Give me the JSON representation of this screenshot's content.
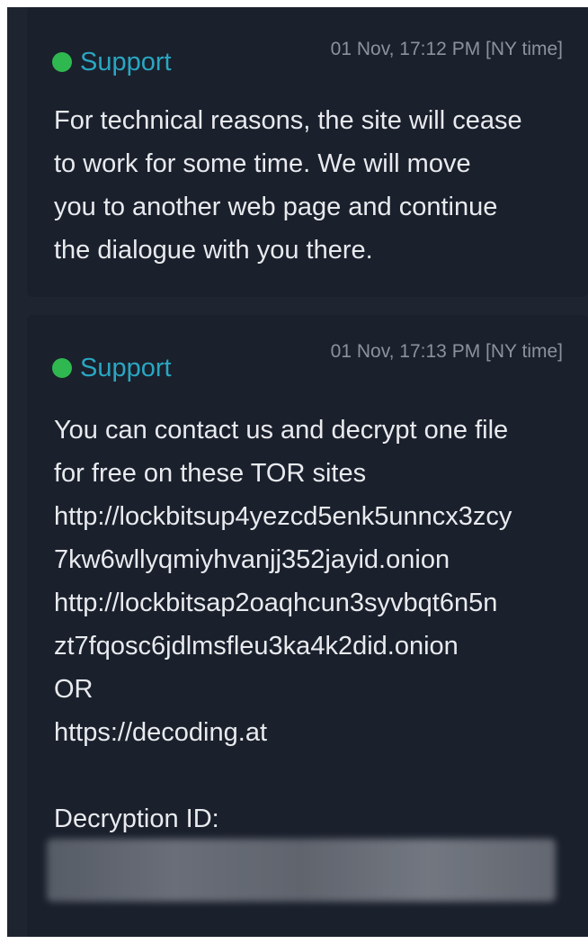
{
  "colors": {
    "frame_bg": "#1e2430",
    "bubble_bg": "#1a202c",
    "online_dot": "#2fb84f",
    "sender_name": "#2aa6c1",
    "timestamp": "#8b929d",
    "body_text": "#e8eaee"
  },
  "messages": [
    {
      "sender": "Support",
      "status_icon": "online-dot-icon",
      "timestamp": "01 Nov, 17:12 PM [NY time]",
      "lines": [
        "For technical reasons, the site will cease",
        "to work for some time. We will move",
        "you to another web page and continue",
        "the dialogue with you there."
      ]
    },
    {
      "sender": "Support",
      "status_icon": "online-dot-icon",
      "timestamp": "01 Nov, 17:13 PM [NY time]",
      "lines": [
        "You can contact us and decrypt one file",
        "for free on these TOR sites",
        "http://lockbitsup4yezcd5enk5unncx3zcy",
        "7kw6wllyqmiyhvanjj352jayid.onion",
        "http://lockbitsap2oaqhcun3syvbqt6n5n",
        "zt7fqosc6jdlmsfleu3ka4k2did.onion",
        "OR",
        "https://decoding.at"
      ],
      "decryption_label": "Decryption ID:"
    }
  ]
}
